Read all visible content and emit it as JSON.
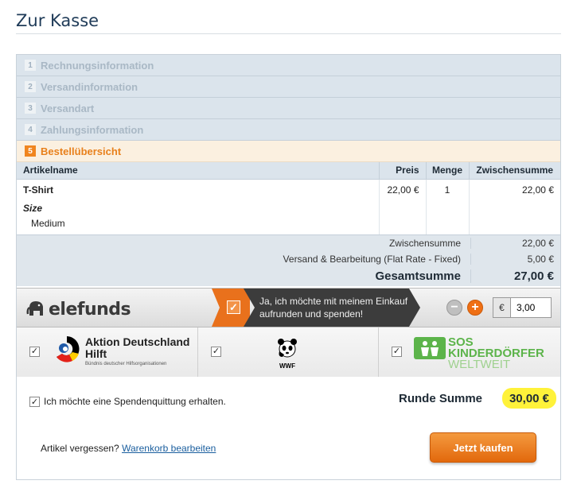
{
  "page": {
    "title": "Zur Kasse"
  },
  "steps": [
    {
      "num": "1",
      "label": "Rechnungsinformation"
    },
    {
      "num": "2",
      "label": "Versandinformation"
    },
    {
      "num": "3",
      "label": "Versandart"
    },
    {
      "num": "4",
      "label": "Zahlungsinformation"
    },
    {
      "num": "5",
      "label": "Bestellübersicht"
    }
  ],
  "table": {
    "headers": {
      "name": "Artikelname",
      "price": "Preis",
      "qty": "Menge",
      "subtotal": "Zwischensumme"
    },
    "items": [
      {
        "name": "T-Shirt",
        "option_label": "Size",
        "option_value": "Medium",
        "price": "22,00 €",
        "qty": "1",
        "subtotal": "22,00 €"
      }
    ]
  },
  "totals": {
    "subtotal_label": "Zwischensumme",
    "subtotal_value": "22,00 €",
    "shipping_label": "Versand & Bearbeitung (Flat Rate - Fixed)",
    "shipping_value": "5,00 €",
    "grand_label": "Gesamtsumme",
    "grand_value": "27,00 €"
  },
  "elefunds": {
    "brand": "elefunds",
    "optin_text": "Ja, ich möchte mit meinem Einkauf aufrunden und spenden!",
    "optin_checked": true,
    "currency": "€",
    "amount": "3,00",
    "minus_icon": "minus-icon",
    "plus_icon": "plus-icon"
  },
  "receivers": [
    {
      "title": "Aktion Deutschland Hilft",
      "subtitle": "Bündnis deutscher Hilfsorganisationen",
      "checked": true
    },
    {
      "title": "WWF",
      "checked": true
    },
    {
      "title_line1": "SOS",
      "title_line2": "KINDERDÖRFER",
      "title_line3": "WELTWEIT",
      "checked": true
    }
  ],
  "receipt": {
    "label": "Ich möchte eine Spendenquittung erhalten.",
    "checked": true
  },
  "round": {
    "label": "Runde Summe",
    "value": "30,00 €"
  },
  "footer": {
    "forgot_text": "Artikel vergessen?",
    "edit_link": "Warenkorb bearbeiten",
    "buy_button": "Jetzt kaufen"
  },
  "colors": {
    "accent": "#e8801c",
    "step_bg": "#dbe4ec",
    "link": "#1a5e9e",
    "highlight": "#fff23a"
  }
}
